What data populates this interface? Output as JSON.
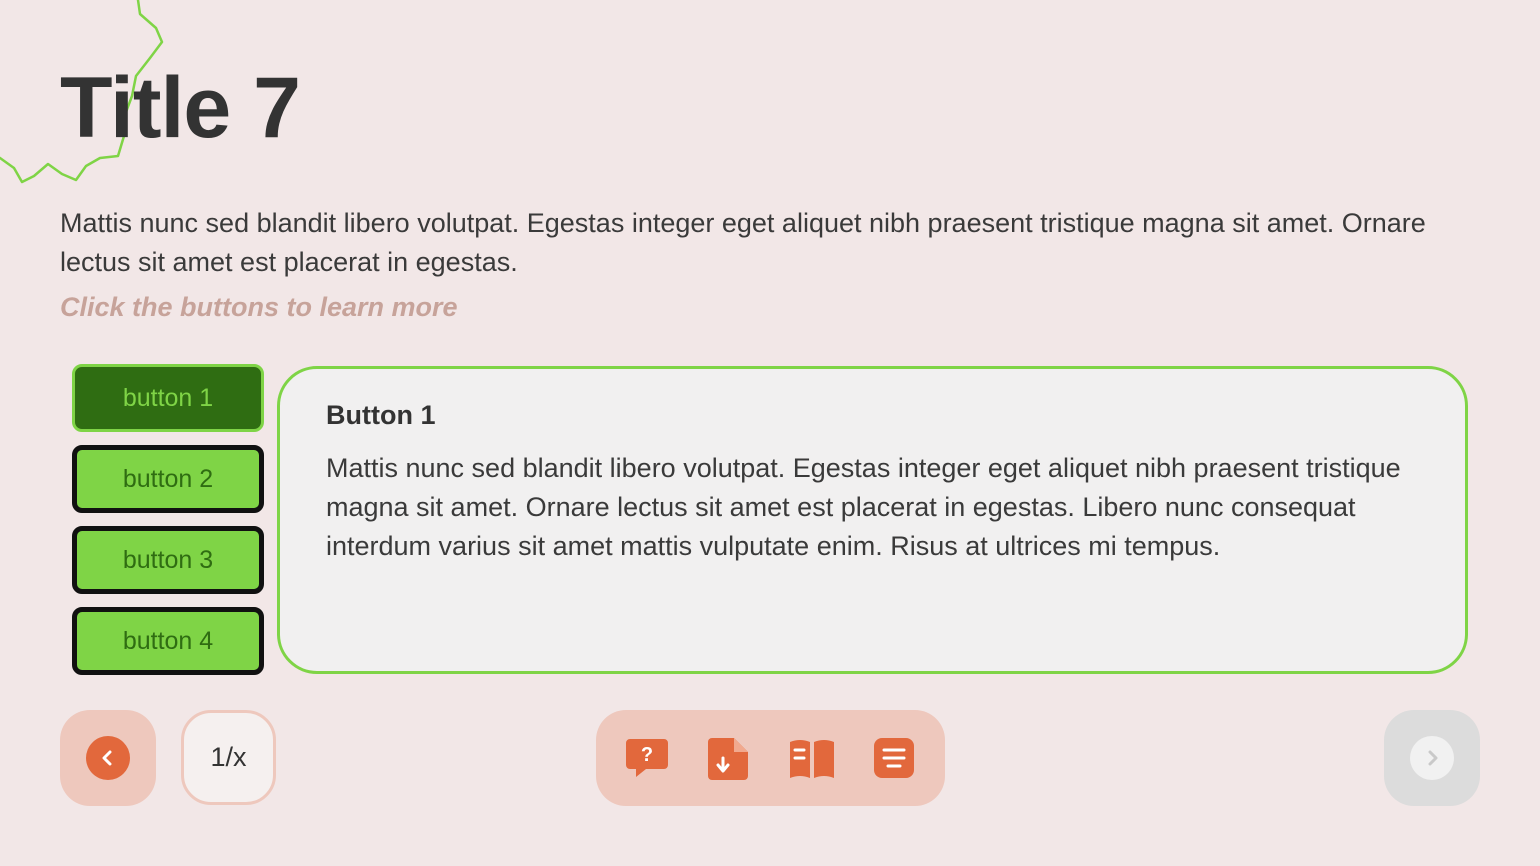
{
  "title": "Title 7",
  "intro": "Mattis nunc sed blandit libero volutpat. Egestas integer eget aliquet nibh praesent tristique magna sit amet. Ornare lectus sit amet est placerat in egestas.",
  "hint": "Click the buttons to learn more",
  "tabs": [
    {
      "label": "button 1",
      "active": true
    },
    {
      "label": "button 2",
      "active": false
    },
    {
      "label": "button 3",
      "active": false
    },
    {
      "label": "button 4",
      "active": false
    }
  ],
  "panel": {
    "title": "Button 1",
    "body": "Mattis nunc sed blandit libero volutpat. Egestas integer eget aliquet nibh praesent tristique magna sit amet. Ornare lectus sit amet est placerat in egestas. Libero nunc consequat interdum varius sit amet mattis vulputate enim. Risus at ultrices mi tempus."
  },
  "nav": {
    "page_counter": "1/x",
    "prev_icon": "chevron-left-icon",
    "next_icon": "chevron-right-icon"
  },
  "toolbar": {
    "icons": [
      "help-chat-icon",
      "download-document-icon",
      "open-book-icon",
      "menu-list-icon"
    ]
  },
  "colors": {
    "background": "#f2e7e7",
    "accent_green": "#7fd446",
    "dark_green": "#2f6d12",
    "accent_orange": "#e2683c",
    "soft_peach": "#eec8bd"
  }
}
